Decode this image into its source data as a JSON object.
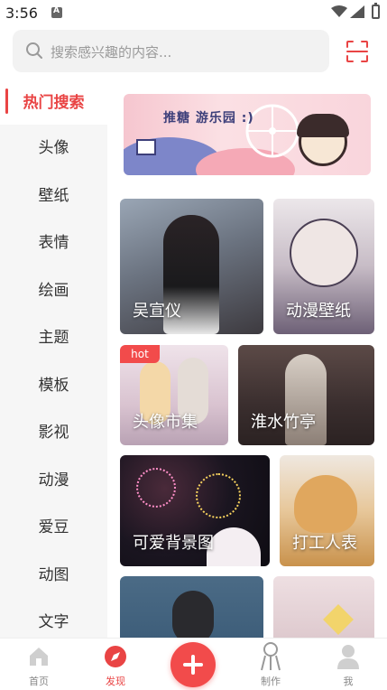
{
  "status_bar": {
    "time": "3:56"
  },
  "search": {
    "placeholder": "搜索感兴趣的内容..."
  },
  "sidebar": {
    "items": [
      {
        "label": "热门搜索",
        "active": true
      },
      {
        "label": "头像"
      },
      {
        "label": "壁纸"
      },
      {
        "label": "表情"
      },
      {
        "label": "绘画"
      },
      {
        "label": "主题"
      },
      {
        "label": "模板"
      },
      {
        "label": "影视"
      },
      {
        "label": "动漫"
      },
      {
        "label": "爱豆"
      },
      {
        "label": "动图"
      },
      {
        "label": "文字"
      }
    ]
  },
  "banner": {
    "title": "推糖 游乐园 :)"
  },
  "cards": [
    {
      "label": "吴宣仪"
    },
    {
      "label": "动漫壁纸"
    },
    {
      "label": "头像市集",
      "badge": "hot"
    },
    {
      "label": "淮水竹亭"
    },
    {
      "label": "可爱背景图"
    },
    {
      "label": "打工人表"
    },
    {
      "label": ""
    },
    {
      "label": ""
    }
  ],
  "bottom_nav": {
    "tabs": [
      {
        "label": "首页"
      },
      {
        "label": "发现",
        "active": true
      },
      {
        "label": ""
      },
      {
        "label": "制作"
      },
      {
        "label": "我"
      }
    ]
  },
  "colors": {
    "accent": "#e94444",
    "sidebar_bg": "#f6f6f6",
    "search_bg": "#f2f2f2"
  }
}
